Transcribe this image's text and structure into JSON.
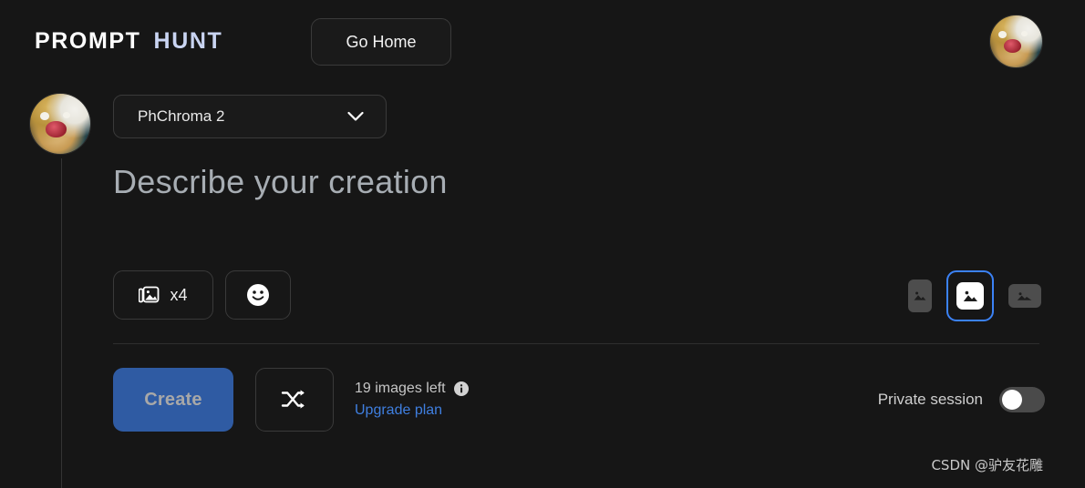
{
  "header": {
    "logo_primary": "PROMPT",
    "logo_secondary": "HUNT",
    "go_home_label": "Go Home",
    "avatar_name": "user-avatar"
  },
  "composer": {
    "model": {
      "selected": "PhChroma 2",
      "chevron_icon": "chevron-down-icon"
    },
    "prompt": {
      "placeholder": "Describe your creation",
      "value": ""
    },
    "toolbar": {
      "image_count_label": "x4",
      "image_count_icon": "images-icon",
      "emoji_icon": "smiley-icon"
    },
    "aspect_ratios": [
      {
        "name": "portrait",
        "selected": false
      },
      {
        "name": "square",
        "selected": true
      },
      {
        "name": "landscape",
        "selected": false
      }
    ],
    "actions": {
      "create_label": "Create",
      "shuffle_icon": "shuffle-icon",
      "quota_text": "19 images left",
      "info_icon": "info-icon",
      "upgrade_label": "Upgrade plan",
      "private_label": "Private session",
      "private_enabled": false
    }
  },
  "watermark": "CSDN @驴友花雕",
  "colors": {
    "background": "#161616",
    "panel": "#1a1a1a",
    "border": "#3a3a3a",
    "accent_blue": "#3b82f6",
    "create_blue": "#2f5ba3",
    "link_blue": "#3f7fe0",
    "logo_secondary": "#c9d4f2",
    "placeholder": "#a7adb3"
  }
}
